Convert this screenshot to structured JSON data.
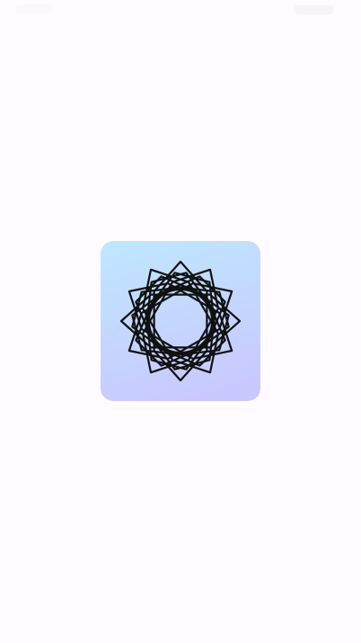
{
  "screen": {
    "type": "app-splash",
    "background_color": "#fffbfe"
  },
  "status_bar": {
    "color": "#fcf7fb"
  },
  "app_icon": {
    "icon": "spirograph-logo-icon",
    "gradient_top": "#bfe6ff",
    "gradient_bottom": "#c9c9ff",
    "stroke_color": "#111111"
  }
}
